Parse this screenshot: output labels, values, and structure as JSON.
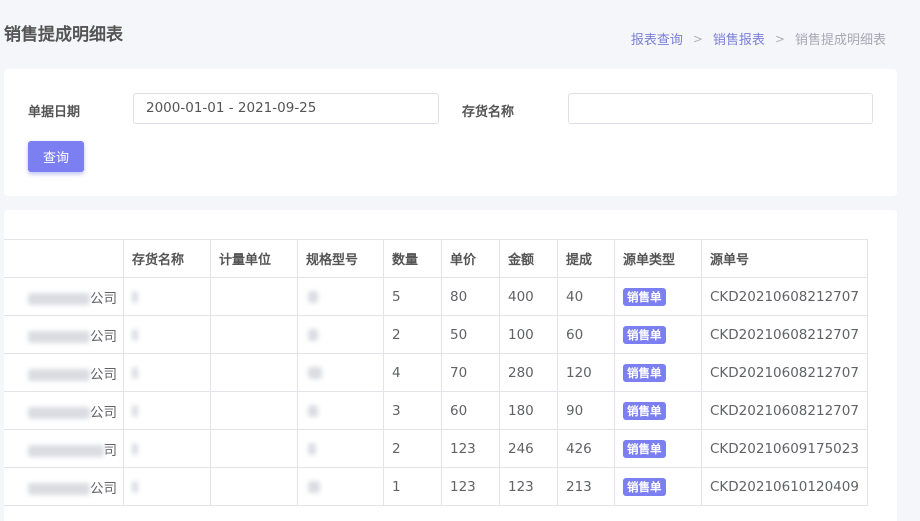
{
  "page": {
    "title": "销售提成明细表",
    "breadcrumb": [
      "报表查询",
      "销售报表",
      "销售提成明细表"
    ]
  },
  "filter": {
    "date_label": "单据日期",
    "date_value": "2000-01-01 - 2021-09-25",
    "goods_label": "存货名称",
    "goods_value": "",
    "query_button": "查询"
  },
  "table": {
    "headers": [
      "",
      "存货名称",
      "计量单位",
      "规格型号",
      "数量",
      "单价",
      "金额",
      "提成",
      "源单类型",
      "源单号"
    ],
    "rows": [
      {
        "customer": "公司",
        "goods": "",
        "unit": "",
        "spec": "",
        "qty": "5",
        "price": "80",
        "amount": "400",
        "commission": "40",
        "source_type": "销售单",
        "source_no": "CKD20210608212707"
      },
      {
        "customer": "公司",
        "goods": "",
        "unit": "",
        "spec": "",
        "qty": "2",
        "price": "50",
        "amount": "100",
        "commission": "60",
        "source_type": "销售单",
        "source_no": "CKD20210608212707"
      },
      {
        "customer": "公司",
        "goods": "",
        "unit": "",
        "spec": "",
        "qty": "4",
        "price": "70",
        "amount": "280",
        "commission": "120",
        "source_type": "销售单",
        "source_no": "CKD20210608212707"
      },
      {
        "customer": "公司",
        "goods": "",
        "unit": "",
        "spec": "",
        "qty": "3",
        "price": "60",
        "amount": "180",
        "commission": "90",
        "source_type": "销售单",
        "source_no": "CKD20210608212707"
      },
      {
        "customer": "司",
        "goods": "",
        "unit": "",
        "spec": "",
        "qty": "2",
        "price": "123",
        "amount": "246",
        "commission": "426",
        "source_type": "销售单",
        "source_no": "CKD20210609175023"
      },
      {
        "customer": "公司",
        "goods": "",
        "unit": "",
        "spec": "",
        "qty": "1",
        "price": "123",
        "amount": "123",
        "commission": "213",
        "source_type": "销售单",
        "source_no": "CKD20210610120409"
      }
    ]
  },
  "colors": {
    "accent": "#7b7ff2",
    "breadcrumb_link": "#7b7fd8",
    "background": "#f5f6fa"
  }
}
